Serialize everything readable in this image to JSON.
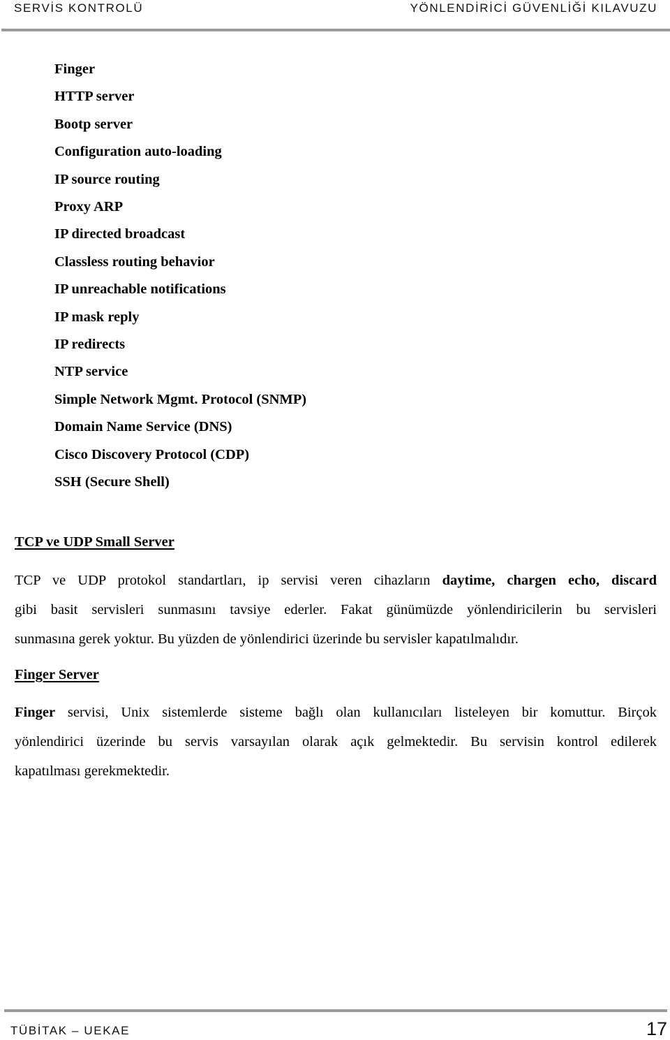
{
  "header": {
    "left_title": "SERVİS KONTROLÜ",
    "right_title": "YÖNLENDİRİCİ GÜVENLİĞİ KILAVUZU"
  },
  "services": [
    "Finger",
    "HTTP server",
    "Bootp server",
    "Configuration auto-loading",
    "IP source routing",
    "Proxy ARP",
    "IP directed broadcast",
    "Classless routing behavior",
    "IP unreachable notifications",
    "IP mask reply",
    "IP redirects",
    "NTP service",
    "Simple Network Mgmt. Protocol (SNMP)",
    "Domain Name Service (DNS)",
    "Cisco Discovery Protocol (CDP)",
    "SSH (Secure Shell)"
  ],
  "sections": {
    "tcp_udp": {
      "heading": "TCP ve UDP Small Server",
      "line1_text": "TCP ve UDP protokol standartları, ip servisi veren cihazların ",
      "line1_bold": "daytime, chargen echo, discard",
      "line2": "gibi basit servisleri sunmasını tavsiye ederler. Fakat günümüzde yönlendiricilerin bu servisleri",
      "line3": "sunmasına gerek yoktur. Bu yüzden de yönlendirici üzerinde bu servisler kapatılmalıdır."
    },
    "finger": {
      "heading": "Finger Server",
      "line1_bold": "Finger",
      "line1_text": " servisi, Unix sistemlerde sisteme bağlı olan kullanıcıları listeleyen bir komuttur. Birçok",
      "line2": "yönlendirici üzerinde bu servis varsayılan olarak açık gelmektedir. Bu servisin kontrol edilerek",
      "line3": "kapatılması gerekmektedir."
    }
  },
  "footer": {
    "org": "TÜBİTAK – UEKAE",
    "page_number": "17"
  }
}
